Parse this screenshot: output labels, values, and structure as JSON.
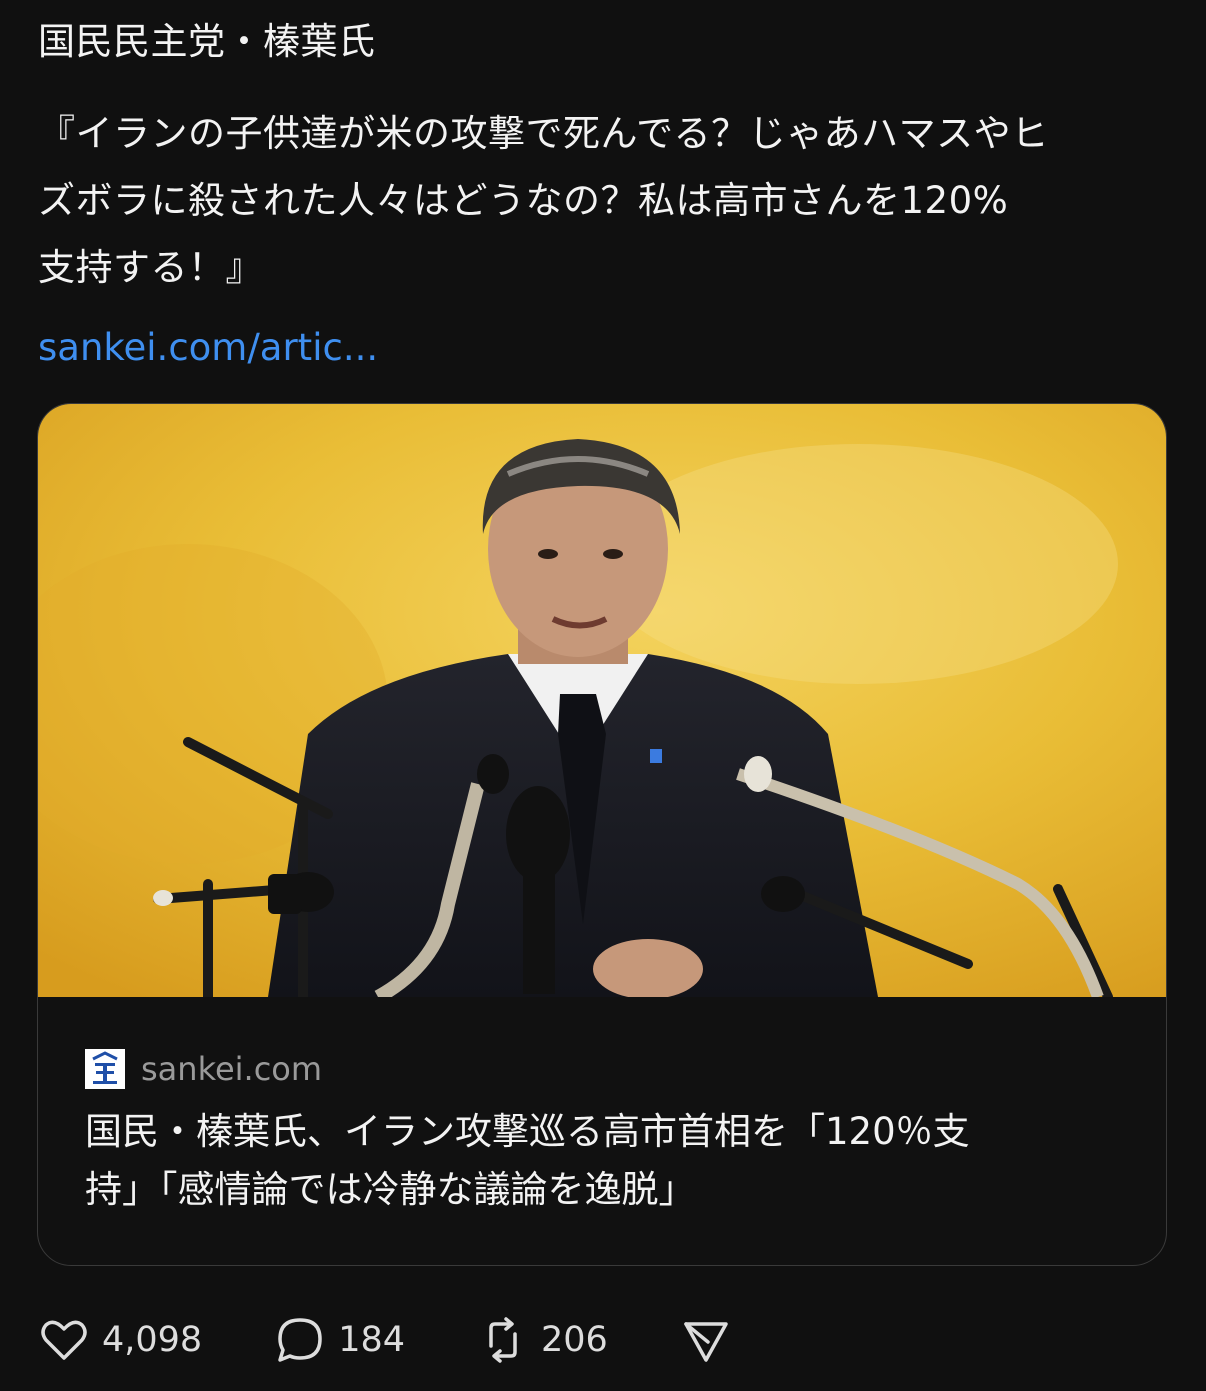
{
  "post": {
    "line1": "国民民主党・榛葉氏",
    "body_lines": [
      "『イランの子供達が米の攻撃で死んでる？じゃあハマスやヒ",
      "ズボラに殺された人々はどうなの？私は高市さんを120%",
      "支持する！』"
    ],
    "link_text": "sankei.com/artic..."
  },
  "card": {
    "site_name": "sankei.com",
    "title_lines": [
      "国民・榛葉氏、イラン攻撃巡る高市首相を「120％支",
      "持」「感情論では冷静な議論を逸脱」"
    ],
    "image_icon": "press-conference-photo"
  },
  "actions": {
    "like": {
      "icon": "heart-icon",
      "count": "4,098"
    },
    "reply": {
      "icon": "comment-icon",
      "count": "184"
    },
    "repost": {
      "icon": "repost-icon",
      "count": "206"
    },
    "share": {
      "icon": "send-icon"
    }
  },
  "colors": {
    "background": "#101010",
    "text": "#f3f3f3",
    "link": "#3f8ff0",
    "muted": "#9a9a9a",
    "card_border": "#3a3a3a"
  }
}
